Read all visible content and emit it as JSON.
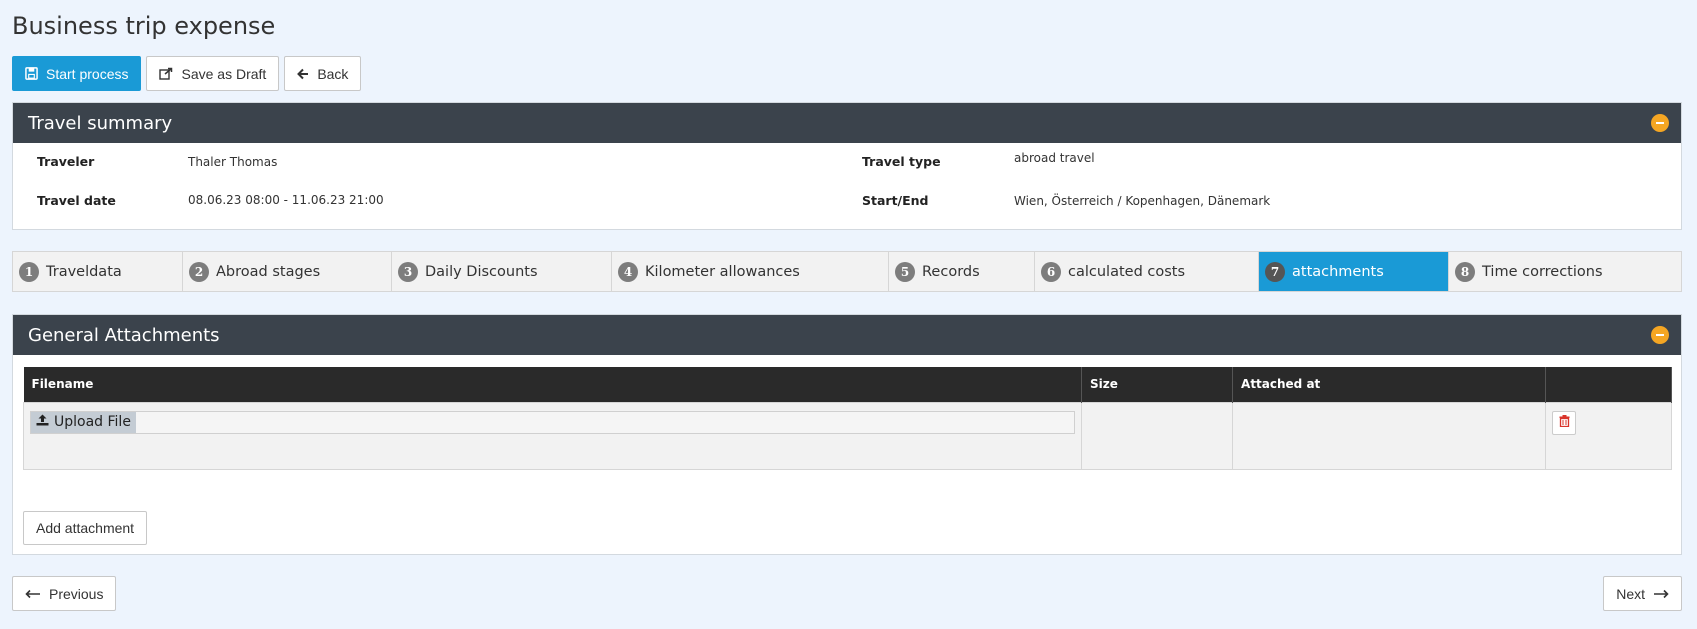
{
  "page": {
    "title": "Business trip expense"
  },
  "toolbar": {
    "start_label": "Start process",
    "draft_label": "Save as Draft",
    "back_label": "Back"
  },
  "summary": {
    "title": "Travel summary",
    "traveler_label": "Traveler",
    "traveler_value": "Thaler Thomas",
    "date_label": "Travel date",
    "date_value": "08.06.23 08:00 - 11.06.23 21:00",
    "type_label": "Travel type",
    "type_value": "abroad travel",
    "startend_label": "Start/End",
    "startend_value": "Wien, Österreich / Kopenhagen, Dänemark"
  },
  "steps": [
    {
      "num": "1",
      "label": "Traveldata"
    },
    {
      "num": "2",
      "label": "Abroad stages"
    },
    {
      "num": "3",
      "label": "Daily Discounts"
    },
    {
      "num": "4",
      "label": "Kilometer allowances"
    },
    {
      "num": "5",
      "label": "Records"
    },
    {
      "num": "6",
      "label": "calculated costs"
    },
    {
      "num": "7",
      "label": "attachments"
    },
    {
      "num": "8",
      "label": "Time corrections"
    }
  ],
  "active_step": "7",
  "attachments": {
    "title": "General Attachments",
    "columns": [
      "Filename",
      "Size",
      "Attached at",
      ""
    ],
    "upload_label": "Upload File",
    "add_label": "Add attachment"
  },
  "nav": {
    "prev_label": "Previous",
    "next_label": "Next"
  },
  "colors": {
    "primary": "#1a9ad6",
    "header": "#3b434c",
    "collapse": "#f5a623",
    "delete": "#d9342b"
  },
  "icons": {
    "start": "save-icon",
    "draft": "share-icon",
    "back": "arrow-left-icon",
    "collapse": "minus-circle-icon",
    "upload": "upload-icon",
    "delete": "trash-icon",
    "prev": "long-arrow-left-icon",
    "next": "long-arrow-right-icon"
  }
}
